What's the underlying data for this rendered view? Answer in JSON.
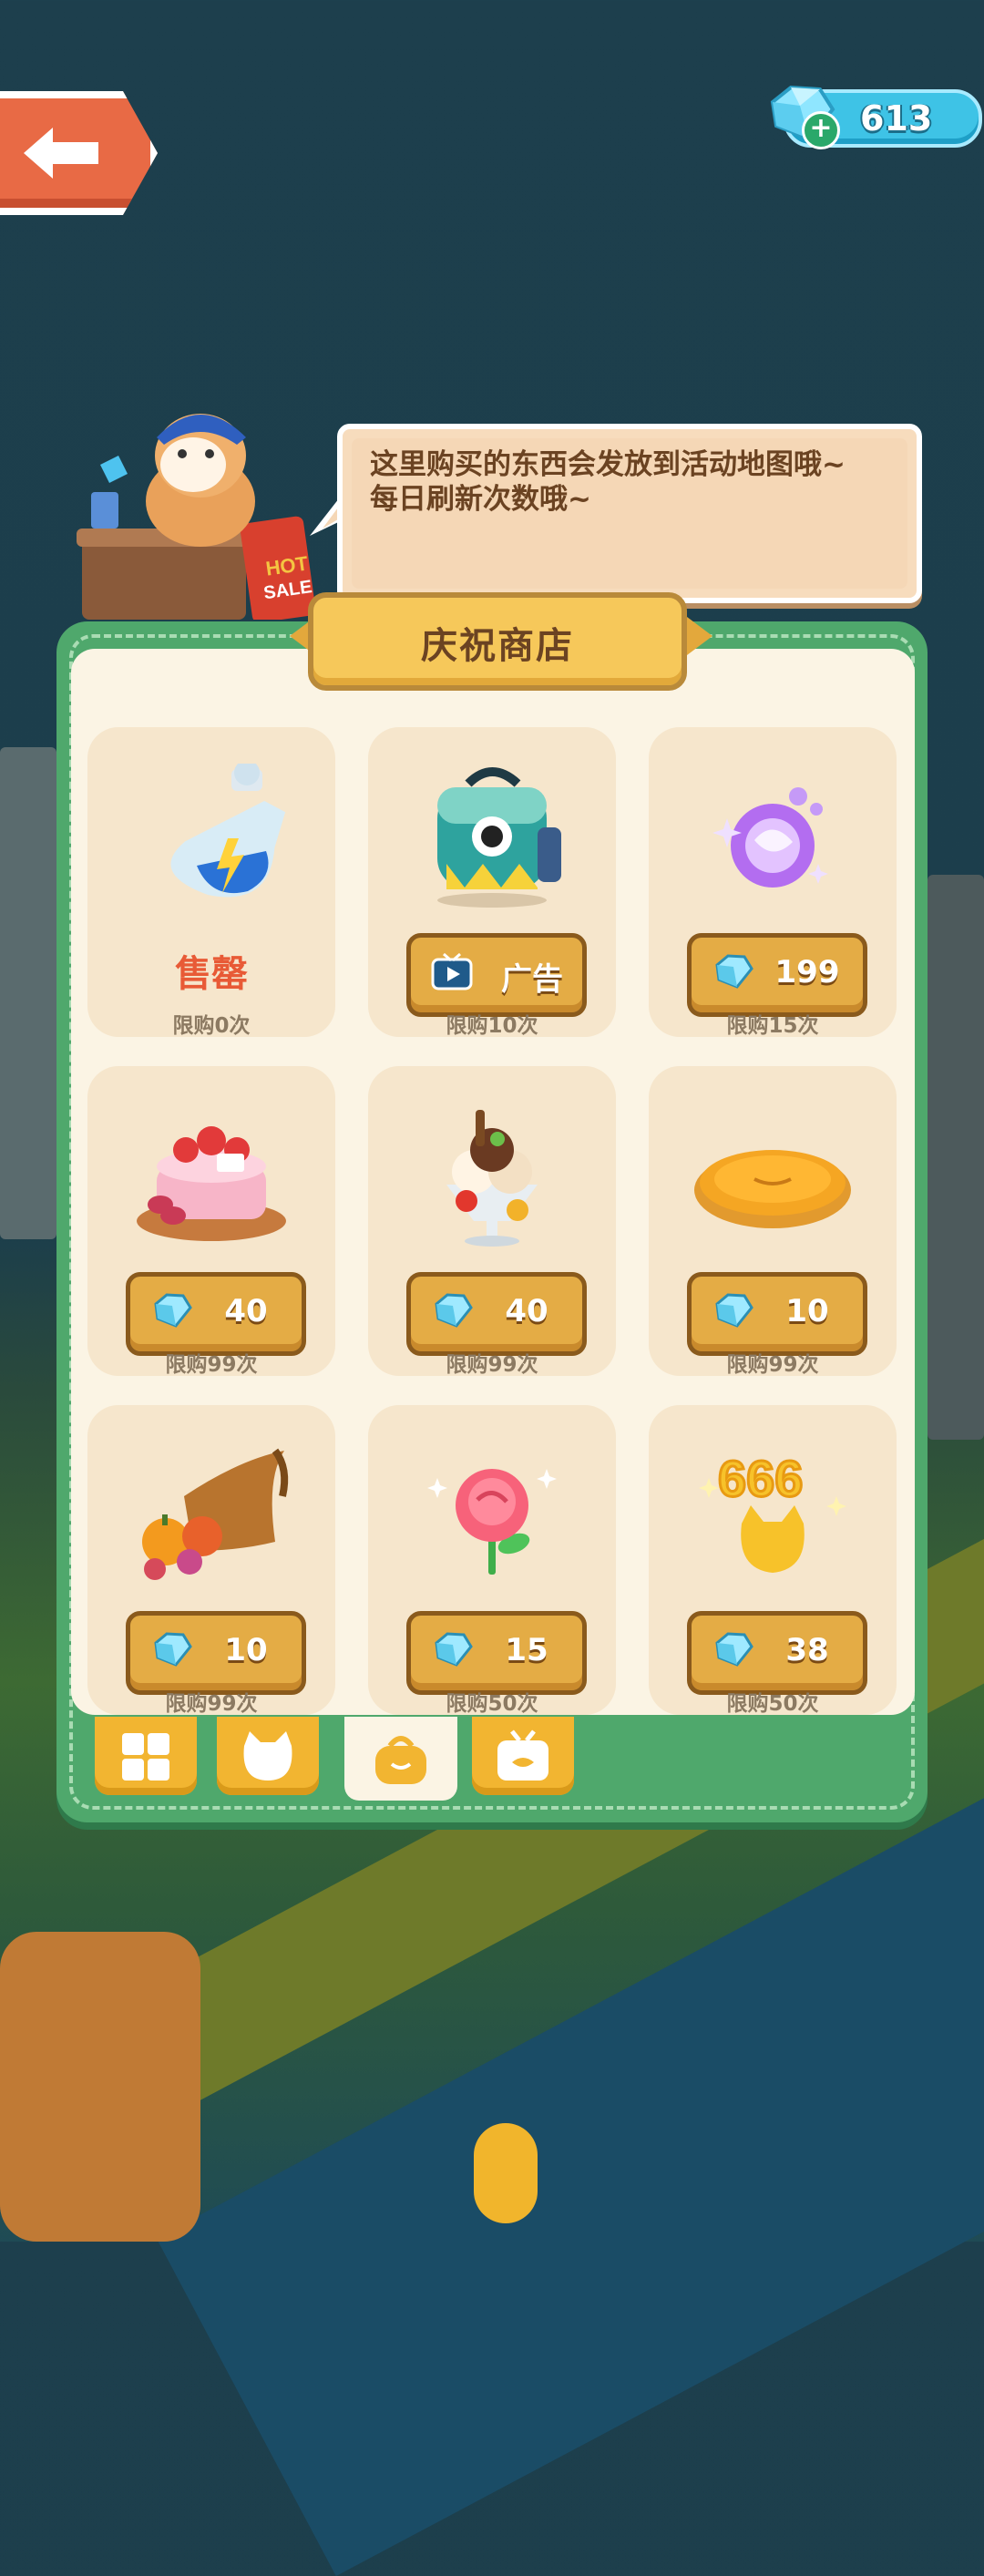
{
  "hud": {
    "gem_count": "613"
  },
  "speech": {
    "text": "这里购买的东西会发放到活动地图哦~\n每日刷新次数哦~"
  },
  "shop": {
    "title": "庆祝商店",
    "items": [
      {
        "name": "energy-potion",
        "status": "售罄",
        "limit": "限购0次"
      },
      {
        "name": "backpack",
        "price": "广告",
        "limit": "限购10次"
      },
      {
        "name": "magic-orb",
        "price": "199",
        "limit": "限购15次"
      },
      {
        "name": "strawberry-cake",
        "price": "40",
        "limit": "限购99次"
      },
      {
        "name": "ice-cream-sundae",
        "price": "40",
        "limit": "限购99次"
      },
      {
        "name": "pie",
        "price": "10",
        "limit": "限购99次"
      },
      {
        "name": "cornucopia",
        "price": "10",
        "limit": "限购99次"
      },
      {
        "name": "rose",
        "price": "15",
        "limit": "限购50次"
      },
      {
        "name": "666-cat-badge",
        "price": "38",
        "limit": "限购50次"
      }
    ]
  },
  "tabs": [
    {
      "icon": "grid-icon",
      "active": false
    },
    {
      "icon": "cat-icon",
      "active": false
    },
    {
      "icon": "bag-icon",
      "active": true
    },
    {
      "icon": "tv-gift-icon",
      "active": false
    }
  ],
  "colors": {
    "panel_green": "#4fa86c",
    "panel_cream": "#fbf4e4",
    "price_gold": "#e4ac45",
    "sold_out_red": "#e85a36",
    "gem_blue": "#3ec3e6"
  }
}
